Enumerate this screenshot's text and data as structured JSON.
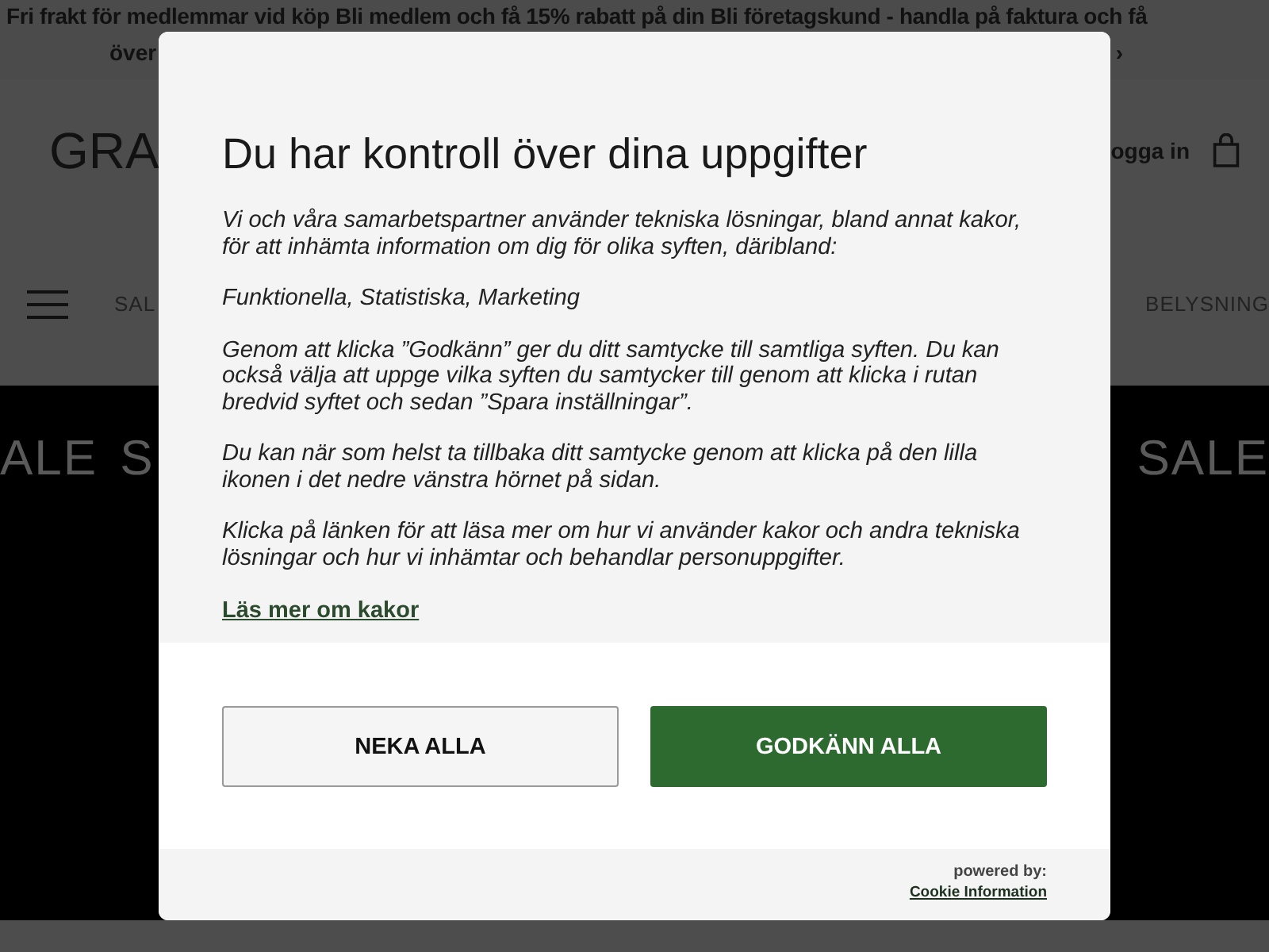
{
  "banner": {
    "line_1": "Fri frakt för medlemmar vid köp Bli medlem och få 15% rabatt på din Bli företagskund - handla på faktura och få",
    "line_2_left": "över",
    "line_2_right": "›"
  },
  "header": {
    "logo": "GRA",
    "login": "ogga in"
  },
  "nav": {
    "left": [
      "SAL"
    ],
    "right": [
      "BELYSNING"
    ]
  },
  "sale_band": {
    "left": [
      "ALE",
      "S"
    ],
    "right": [
      "SALE"
    ]
  },
  "consent": {
    "title": "Du har kontroll över dina uppgifter",
    "paragraphs": [
      "Vi och våra samarbetspartner använder tekniska lösningar, bland annat kakor, för att inhämta information om dig för olika syften, däribland:",
      "Funktionella, Statistiska, Marketing",
      "Genom att klicka ”Godkänn” ger du ditt samtycke till samtliga syften. Du kan också välja att uppge vilka syften du samtycker till genom att klicka i rutan bredvid syftet och sedan ”Spara inställningar”.",
      "Du kan när som helst ta tillbaka ditt samtycke genom att klicka på den lilla ikonen i det nedre vänstra hörnet på sidan.",
      "Klicka på länken för att läsa mer om hur vi använder kakor och andra tekniska lösningar och hur vi inhämtar och behandlar personuppgifter."
    ],
    "link": "Läs mer om kakor",
    "buttons": [
      {
        "label": "NEKA ALLA",
        "kind": "secondary"
      },
      {
        "label": "GODKÄNN ALLA",
        "kind": "primary"
      }
    ],
    "powered_by": "powered by:",
    "provider_link": "Cookie Information"
  }
}
